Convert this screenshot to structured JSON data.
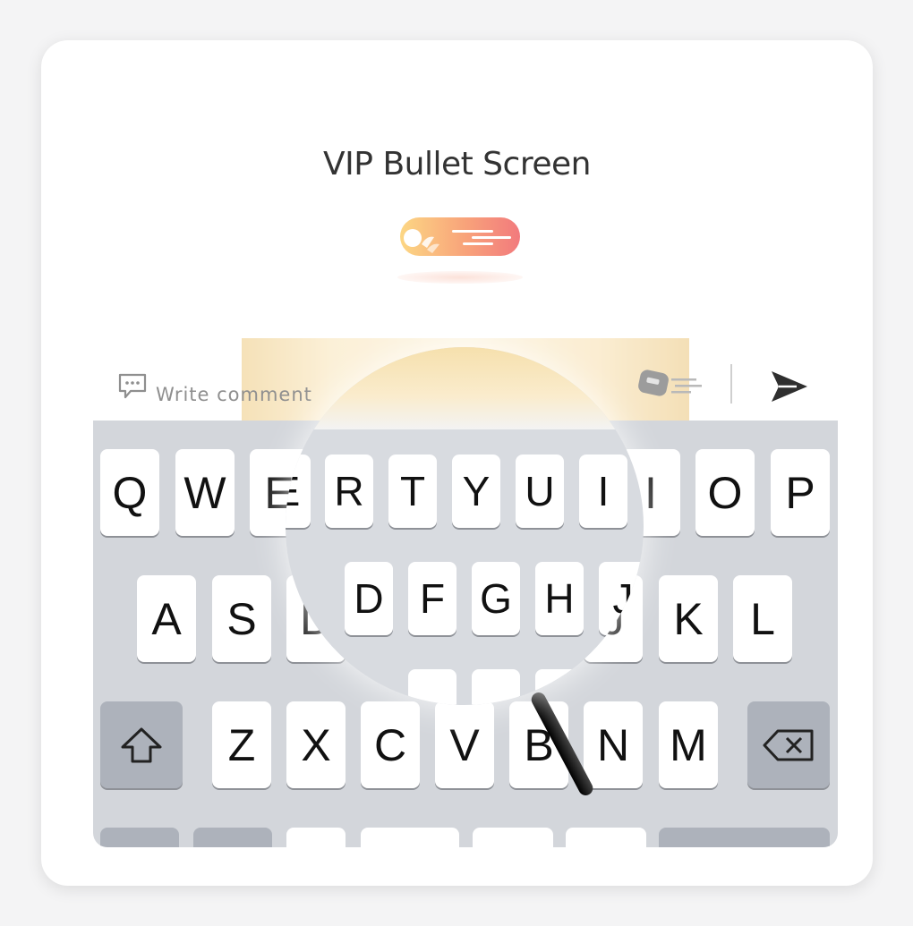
{
  "card": {
    "title": "VIP Bullet Screen"
  },
  "comment_bar": {
    "placeholder": "Write comment",
    "icons": [
      "comment-icon",
      "bullet-screen-icon",
      "send-icon"
    ]
  },
  "keyboard": {
    "row1": [
      "Q",
      "W",
      "E",
      "R",
      "T",
      "Y",
      "U",
      "I",
      "O",
      "P"
    ],
    "row2": [
      "A",
      "S",
      "D",
      "F",
      "G",
      "H",
      "J",
      "K",
      "L"
    ],
    "row3": [
      "Z",
      "X",
      "C",
      "V",
      "B",
      "N",
      "M"
    ],
    "shift_icon": "shift-icon",
    "delete_icon": "backspace-icon"
  },
  "magnifier": {
    "row1": [
      "E",
      "R",
      "T",
      "Y",
      "U",
      "I"
    ],
    "row2": [
      "D",
      "F",
      "G",
      "H",
      "J"
    ]
  },
  "colors": {
    "pill_start": "#fcd784",
    "pill_end": "#f27a7d",
    "keyboard_bg": "#d3d6db"
  }
}
